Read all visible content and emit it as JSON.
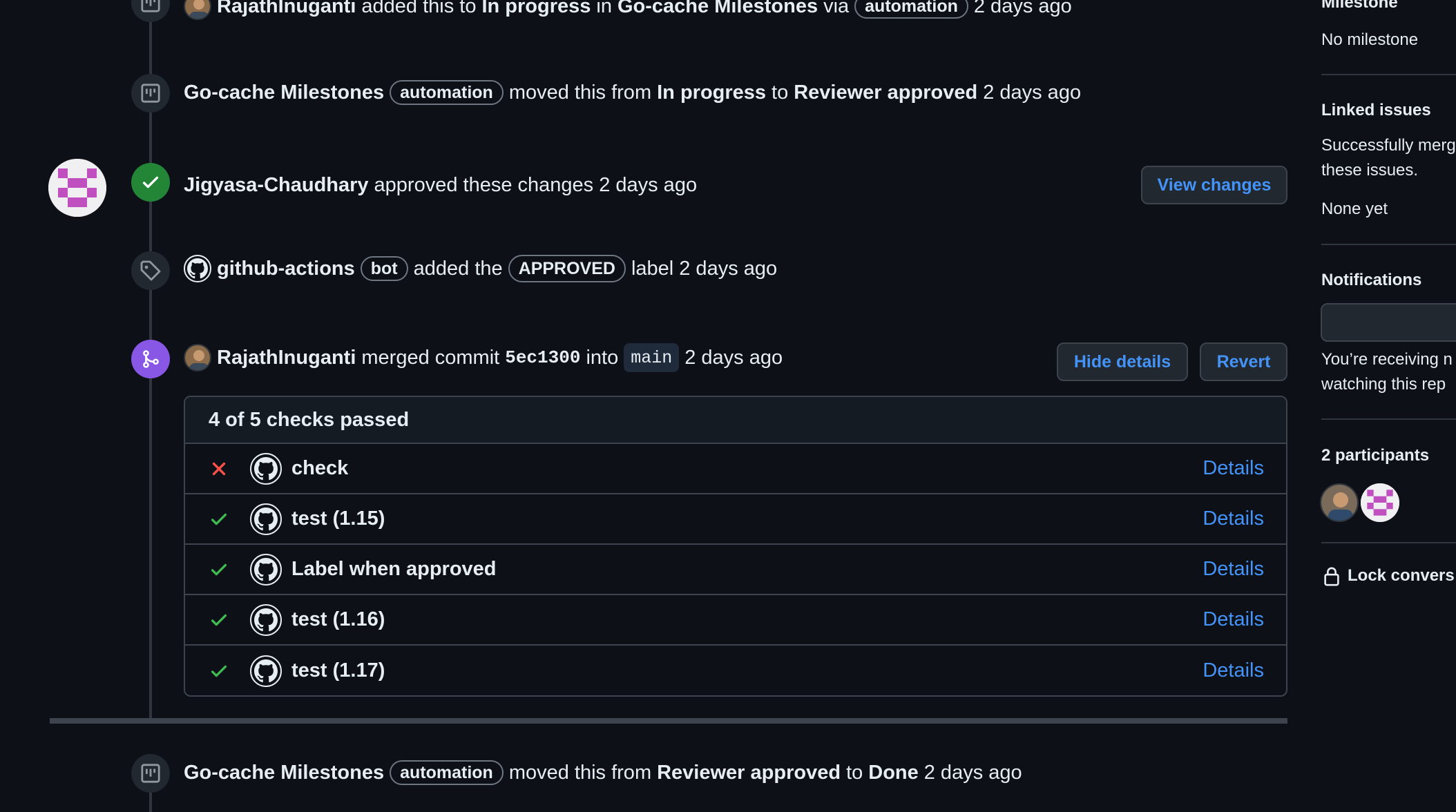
{
  "timeline": {
    "event_added": {
      "actor": "RajathInuganti",
      "text_added": "added this to",
      "status": "In progress",
      "text_in": "in",
      "project": "Go-cache Milestones",
      "text_via": "via",
      "badge": "automation",
      "time": "2 days ago"
    },
    "event_moved_1": {
      "actor": "Go-cache Milestones",
      "badge": "automation",
      "text_moved": "moved this from",
      "from": "In progress",
      "text_to": "to",
      "to": "Reviewer approved",
      "time": "2 days ago"
    },
    "event_approved": {
      "actor": "Jigyasa-Chaudhary",
      "text": "approved these changes",
      "time": "2 days ago",
      "button": "View changes"
    },
    "event_label": {
      "actor": "github-actions",
      "badge": "bot",
      "text_added": "added the",
      "label": "APPROVED",
      "text_label": "label",
      "time": "2 days ago"
    },
    "event_merged": {
      "actor": "RajathInuganti",
      "text_merged": "merged commit",
      "commit": "5ec1300",
      "text_into": "into",
      "branch": "main",
      "time": "2 days ago",
      "hide_button": "Hide details",
      "revert_button": "Revert"
    },
    "checks": {
      "summary": "4 of 5 checks passed",
      "details_label": "Details",
      "items": [
        {
          "name": "check",
          "status": "failed"
        },
        {
          "name": "test (1.15)",
          "status": "passed"
        },
        {
          "name": "Label when approved",
          "status": "passed"
        },
        {
          "name": "test (1.16)",
          "status": "passed"
        },
        {
          "name": "test (1.17)",
          "status": "passed"
        }
      ]
    },
    "event_moved_2": {
      "actor": "Go-cache Milestones",
      "badge": "automation",
      "text_moved": "moved this from",
      "from": "Reviewer approved",
      "text_to": "to",
      "to": "Done",
      "time": "2 days ago"
    }
  },
  "sidebar": {
    "milestone_title": "Milestone",
    "milestone_value": "No milestone",
    "linked_title": "Linked issues",
    "linked_text_1": "Successfully merg",
    "linked_text_2": "these issues.",
    "linked_value": "None yet",
    "notifications_title": "Notifications",
    "notifications_text_1": "You’re receiving n",
    "notifications_text_2": "watching this rep",
    "participants_title": "2 participants",
    "lock_label": "Lock convers"
  },
  "colors": {
    "background": "#0d1117",
    "link": "#4493f8",
    "success": "#3fb950",
    "danger": "#f85149",
    "merged": "#8957e5",
    "approved_icon": "#238636"
  }
}
